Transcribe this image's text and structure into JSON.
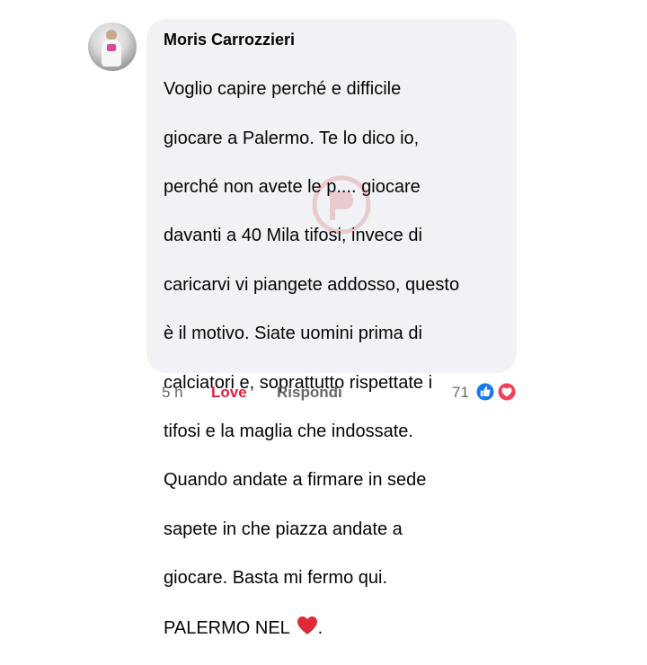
{
  "comment": {
    "author": "Moris Carrozzieri",
    "text_lines": [
      "Voglio capire perché e difficile",
      "giocare a Palermo. Te lo dico io,",
      "perché non avete le p.... giocare",
      "davanti a 40 Mila tifosi, invece di",
      "caricarvi vi piangete addosso, questo",
      "è il motivo. Siate uomini prima di",
      "calciatori e, soprattutto rispettate i",
      "tifosi e la maglia che indossate.",
      "Quando andate a firmare in sede",
      "sapete in che piazza andate a",
      "giocare. Basta mi fermo qui."
    ],
    "last_line_prefix": "PALERMO NEL ",
    "last_line_suffix": ".",
    "heart_emoji": "red-heart-emoji"
  },
  "actions": {
    "time": "5 h",
    "love_label": "Love",
    "reply_label": "Rispondi"
  },
  "reactions": {
    "count": "71",
    "icons": [
      "like-icon",
      "love-icon"
    ],
    "like_color": "#1877f2",
    "love_color": "#f33e58"
  },
  "colors": {
    "bubble": "#f0f2f5",
    "text": "#050505",
    "meta": "#65676b",
    "love_active": "#e41e3f"
  }
}
